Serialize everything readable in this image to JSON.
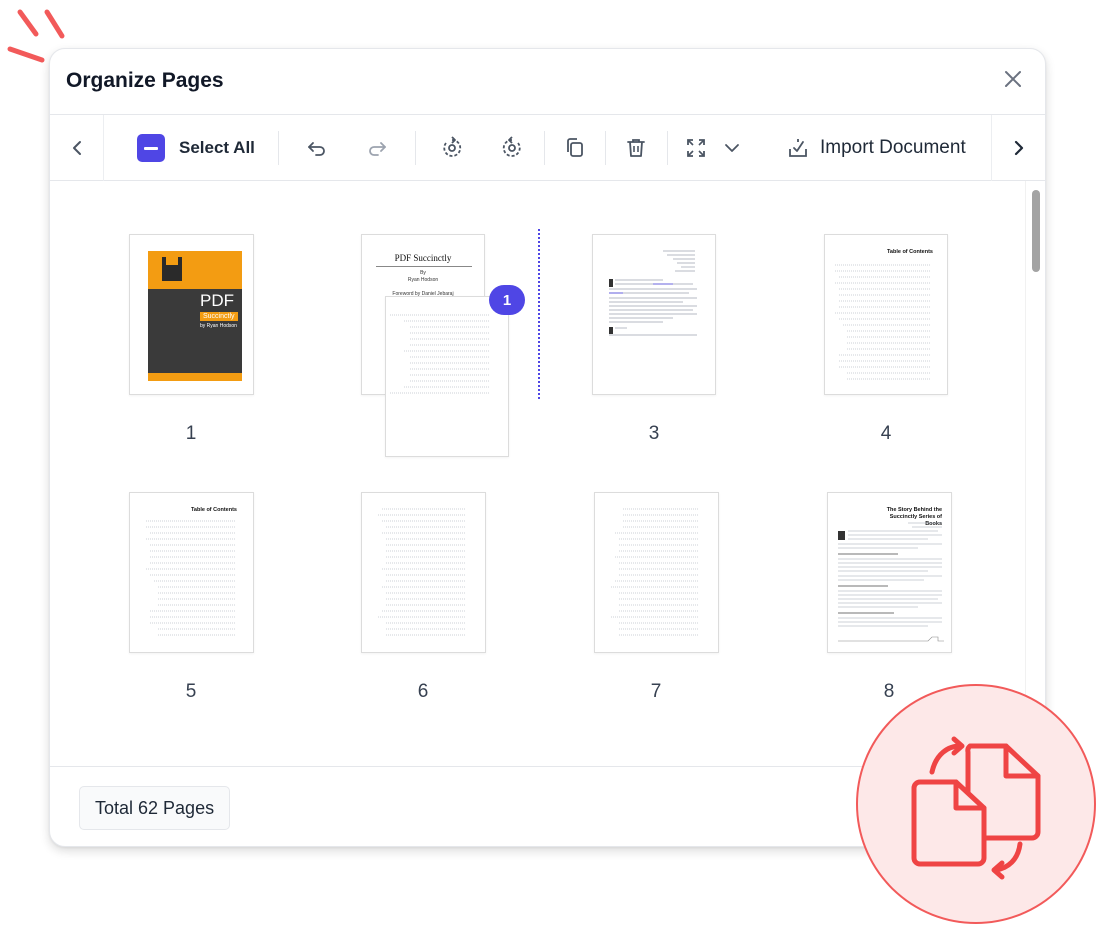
{
  "dialog": {
    "title": "Organize Pages"
  },
  "toolbar": {
    "select_all_label": "Select All",
    "import_label": "Import Document",
    "icons": [
      "chevron-left-icon",
      "minus-checkbox-icon",
      "undo-icon",
      "redo-icon",
      "rotate-left-icon",
      "rotate-right-icon",
      "copy-icon",
      "trash-icon",
      "expand-icon",
      "chevron-down-icon",
      "import-document-icon",
      "chevron-right-icon"
    ]
  },
  "pages": [
    {
      "number": "1",
      "kind": "cover"
    },
    {
      "number": "2",
      "kind": "title",
      "heading": "PDF Succinctly",
      "byline": "By",
      "author": "Ryan Hodson",
      "foreword": "Foreword by Daniel Jebaraj",
      "selected_badge": "1"
    },
    {
      "number": "3",
      "kind": "copyright"
    },
    {
      "number": "4",
      "kind": "toc",
      "heading": "Table of Contents"
    },
    {
      "number": "5",
      "kind": "toc",
      "heading": "Table of Contents"
    },
    {
      "number": "6",
      "kind": "toc-continued"
    },
    {
      "number": "7",
      "kind": "toc-continued"
    },
    {
      "number": "8",
      "kind": "article",
      "heading": "The Story Behind the Succinctly Series of Books"
    }
  ],
  "cover": {
    "title": "PDF",
    "subtitle": "Succinctly",
    "author": "by Ryan Hodson",
    "colors": {
      "top": "#f39c12",
      "bottom": "#3a3a3a",
      "tag": "#f39c12"
    }
  },
  "footer": {
    "total_label": "Total 62 Pages"
  },
  "colors": {
    "accent": "#4f46e5",
    "badge_red": "#ef4444",
    "badge_bg": "#fde8e8"
  }
}
